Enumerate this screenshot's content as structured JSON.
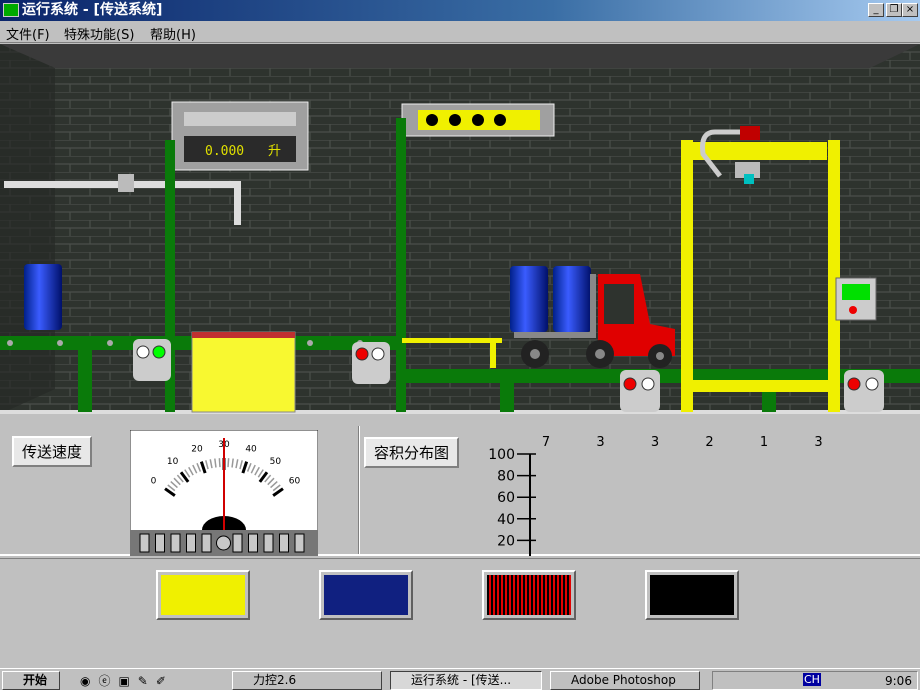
{
  "window": {
    "title": "运行系统 - [传送系统]",
    "minimize": "_",
    "restore": "❐",
    "close": "×"
  },
  "menu": [
    {
      "label": "文件(F)"
    },
    {
      "label": "特殊功能(S)"
    },
    {
      "label": "帮助(H)"
    }
  ],
  "scene": {
    "volume_display": "0.000",
    "volume_unit": "升"
  },
  "panel": {
    "speed_label": "传送速度",
    "gauge": {
      "ticks": [
        "0",
        "10",
        "20",
        "30",
        "40",
        "50",
        "60"
      ],
      "value": 30,
      "min": 0,
      "max": 60
    },
    "volume_chart_label": "容积分布图"
  },
  "chart_data": {
    "type": "bar",
    "top_labels": [
      "7",
      "3",
      "3",
      "2",
      "1",
      "3"
    ],
    "ytick_labels": [
      "100",
      "80",
      "60",
      "40",
      "20"
    ],
    "ylim": [
      0,
      100
    ]
  },
  "thumbnails": [
    {
      "name": "flow-diagram"
    },
    {
      "name": "conveyor-scene"
    },
    {
      "name": "red-waveform"
    },
    {
      "name": "black-display"
    }
  ],
  "taskbar": {
    "start": "开始",
    "tasks": [
      "力控2.6",
      "运行系统 - [传送...",
      "Adobe Photoshop"
    ],
    "tray_lang": "CH",
    "clock": "9:06"
  }
}
